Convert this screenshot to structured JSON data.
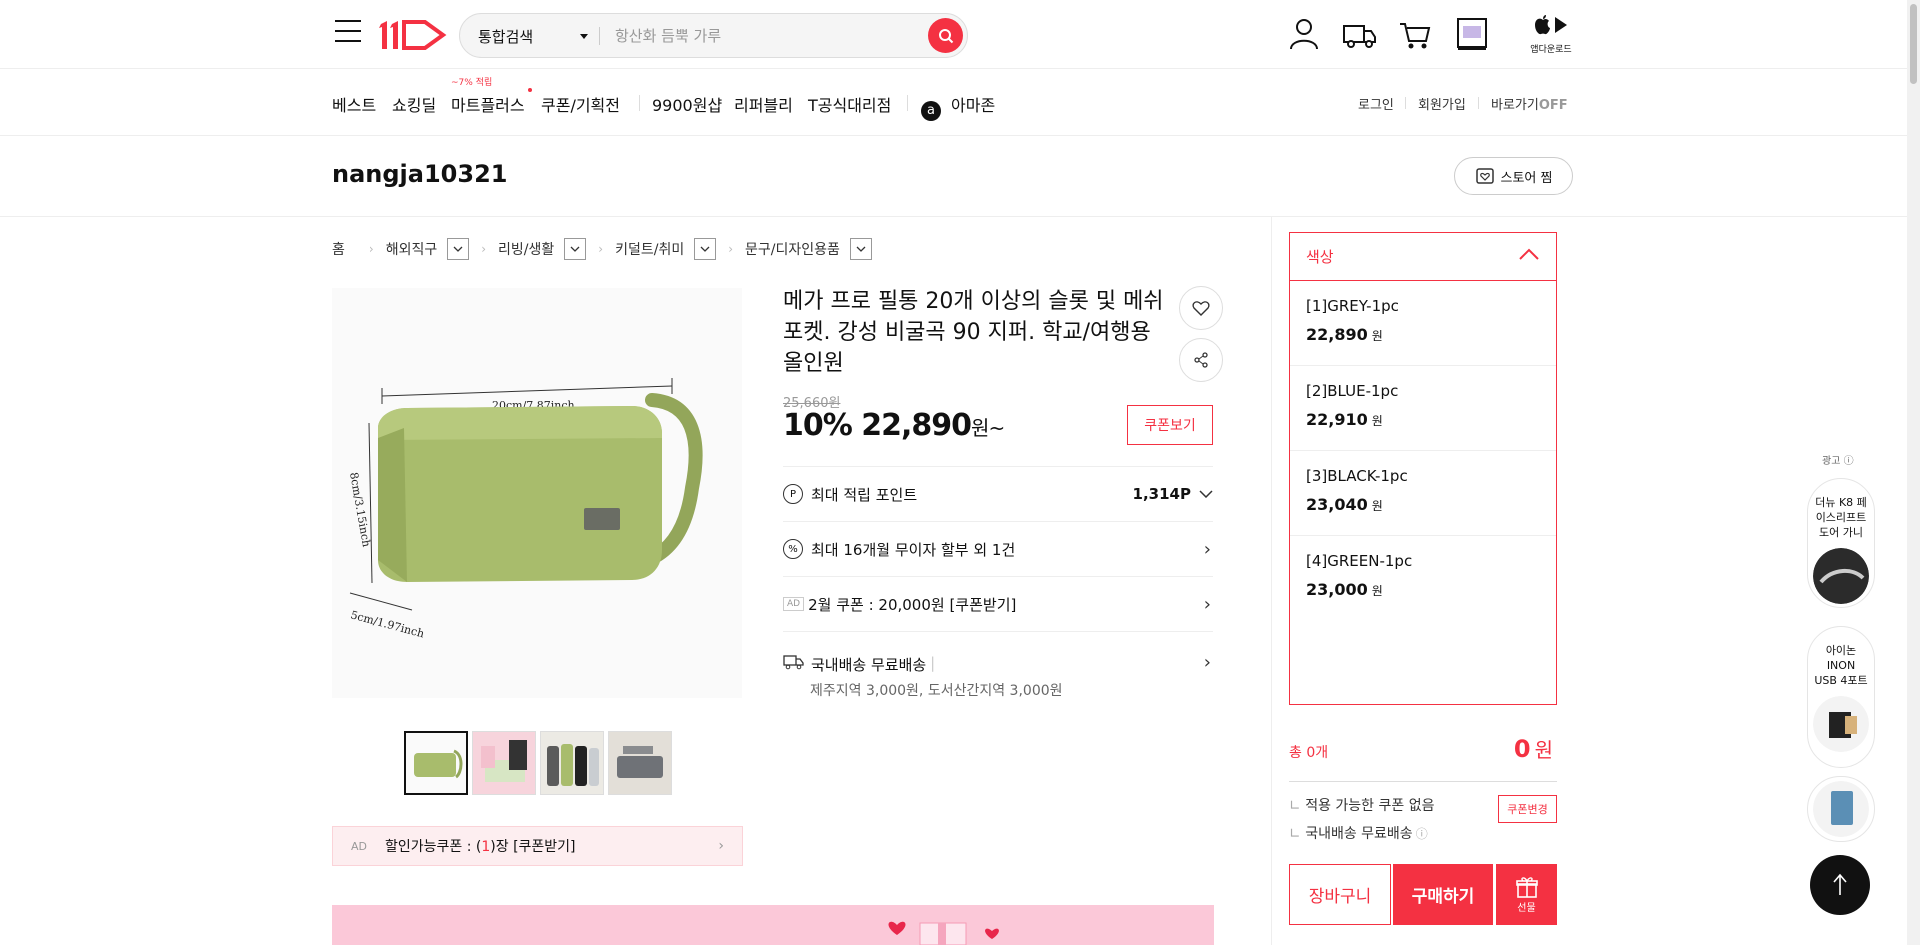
{
  "header": {
    "search_category": "통합검색",
    "search_placeholder": "항산화 듬뿍 가루",
    "app_download": "앱다운로드"
  },
  "nav": {
    "items": [
      "베스트",
      "쇼킹딜",
      "마트플러스",
      "쿠폰/기획전",
      "9900원샵",
      "리퍼블리",
      "T공식대리점",
      "아마존"
    ],
    "mart_tag": "~7% 적립",
    "amazon_icon": "a",
    "login": "로그인",
    "signup": "회원가입",
    "shortcut": "바로가기",
    "shortcut_state": "OFF"
  },
  "store": {
    "name": "nangja10321",
    "zzim_label": "스토어 찜"
  },
  "breadcrumb": {
    "home": "홈",
    "items": [
      "해외직구",
      "리빙/생활",
      "키덜트/취미",
      "문구/디자인용품"
    ]
  },
  "product": {
    "title": "메가 프로 필통 20개 이상의 슬롯 및 메쉬 포켓. 강성 비굴곡 90 지퍼. 학교/여행용 올인원",
    "image_dims": {
      "width": "20cm/7.87inch",
      "height": "8cm/3.15inch",
      "depth": "5cm/1.97inch"
    },
    "thumb_count": 4,
    "old_price": "25,660원",
    "discount": "10%",
    "price": "22,890",
    "price_unit": "원~",
    "coupon_view": "쿠폰보기",
    "points_label": "최대 적립 포인트",
    "points_value": "1,314P",
    "installment": "최대 16개월 무이자 할부 외 1건",
    "ad_tag": "AD",
    "feb_coupon": "2월 쿠폰 : 20,000원 [쿠폰받기]",
    "shipping": "국내배송 무료배송",
    "shipping_extra": "제주지역 3,000원, 도서산간지역 3,000원",
    "discount_coupon_ad": "AD",
    "discount_coupon_prefix": "할인가능쿠폰 : (",
    "discount_coupon_count": "1",
    "discount_coupon_suffix": ")장 [쿠폰받기]"
  },
  "options": {
    "header": "색상",
    "items": [
      {
        "name": "[1]GREY-1pc",
        "price": "22,890"
      },
      {
        "name": "[2]BLUE-1pc",
        "price": "22,910"
      },
      {
        "name": "[3]BLACK-1pc",
        "price": "23,040"
      },
      {
        "name": "[4]GREEN-1pc",
        "price": "23,000"
      }
    ],
    "won": "원"
  },
  "summary": {
    "total_label": "총 0개",
    "total_value": "0",
    "total_unit": "원",
    "coupon_none": "적용 가능한 쿠폰 없음",
    "coupon_change": "쿠폰변경",
    "shipping": "국내배송 무료배송",
    "cart": "장바구니",
    "buy": "구매하기",
    "gift": "선물"
  },
  "ads": {
    "label": "광고",
    "card1": "더뉴 K8 페이스리프트 도어 가니",
    "card2": "아이논 INON USB 4포트"
  },
  "colors": {
    "accent": "#f43142",
    "product_green": "#a8bc6c"
  }
}
